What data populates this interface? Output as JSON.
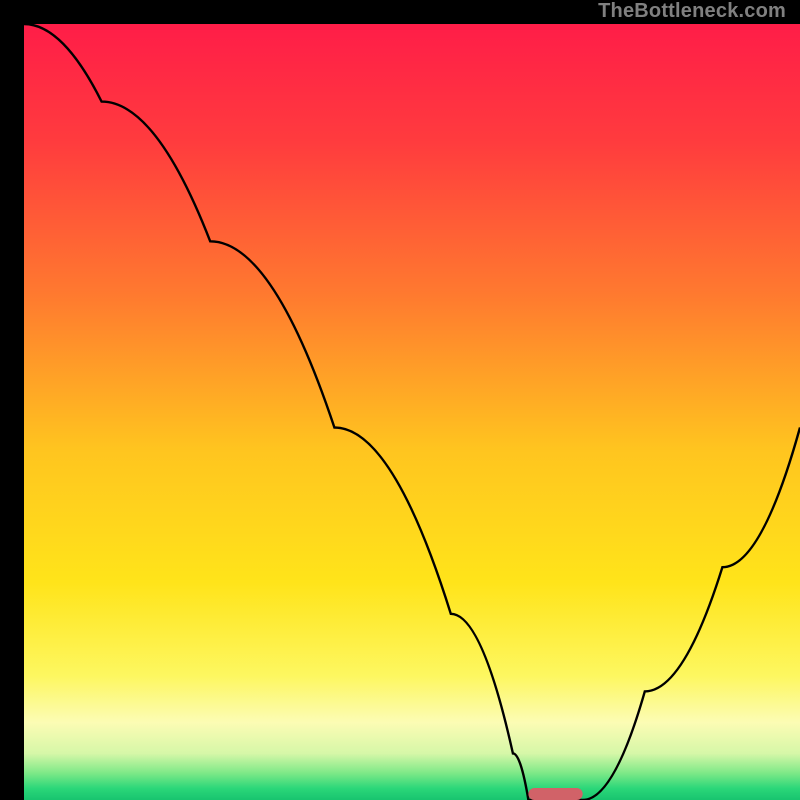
{
  "watermark": "TheBottleneck.com",
  "colors": {
    "frame": "#000000",
    "curve_stroke": "#000000",
    "sweet_spot": "#d16268",
    "gradient_stops": [
      {
        "offset": 0.0,
        "color": "#ff1d48"
      },
      {
        "offset": 0.15,
        "color": "#ff3b3e"
      },
      {
        "offset": 0.35,
        "color": "#ff7a2f"
      },
      {
        "offset": 0.55,
        "color": "#ffc51f"
      },
      {
        "offset": 0.72,
        "color": "#ffe41a"
      },
      {
        "offset": 0.84,
        "color": "#fdf760"
      },
      {
        "offset": 0.9,
        "color": "#fcfcb4"
      },
      {
        "offset": 0.94,
        "color": "#d6f7a8"
      },
      {
        "offset": 0.965,
        "color": "#7fe988"
      },
      {
        "offset": 0.985,
        "color": "#2bd779"
      },
      {
        "offset": 1.0,
        "color": "#18c46f"
      }
    ]
  },
  "chart_data": {
    "type": "line",
    "title": "",
    "xlabel": "",
    "ylabel": "",
    "xlim": [
      0,
      100
    ],
    "ylim": [
      0,
      100
    ],
    "sweet_spot": {
      "x_start": 65,
      "x_end": 72,
      "y": 0
    },
    "series": [
      {
        "name": "bottleneck-curve",
        "x": [
          0,
          10,
          24,
          40,
          55,
          63,
          65,
          68,
          72,
          80,
          90,
          100
        ],
        "y": [
          100,
          90,
          72,
          48,
          24,
          6,
          0,
          0,
          0,
          14,
          30,
          48
        ]
      }
    ]
  }
}
